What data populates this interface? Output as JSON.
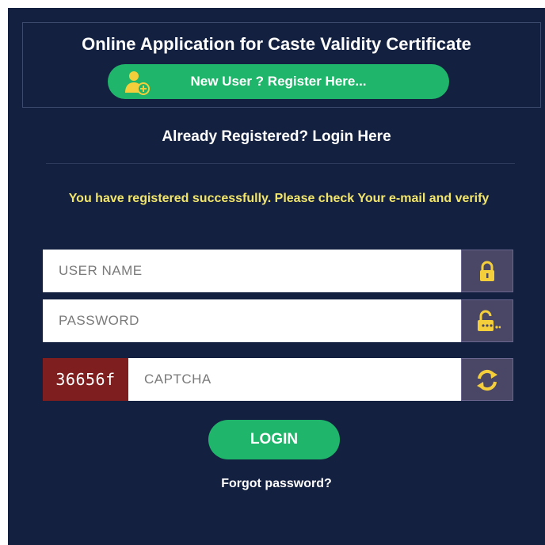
{
  "header": {
    "title": "Online Application for Caste Validity Certificate",
    "register_label": "New User ? Register Here..."
  },
  "login": {
    "heading": "Already Registered? Login Here",
    "message": "You have registered successfully. Please check Your e-mail and verify",
    "username_placeholder": "USER NAME",
    "password_placeholder": "PASSWORD",
    "captcha_code": "36656f",
    "captcha_placeholder": "CAPTCHA",
    "login_label": "LOGIN",
    "forgot_label": "Forgot password?"
  },
  "icons": {
    "register": "add-user-icon",
    "username": "lock-icon",
    "password": "unlock-key-icon",
    "captcha": "refresh-icon"
  },
  "colors": {
    "background": "#14203f",
    "accent_green": "#1fb56a",
    "message_yellow": "#f2e66a",
    "icon_yellow": "#f5cf3b",
    "captcha_bg": "#7f1e1e",
    "addon_bg": "#4a4766"
  }
}
